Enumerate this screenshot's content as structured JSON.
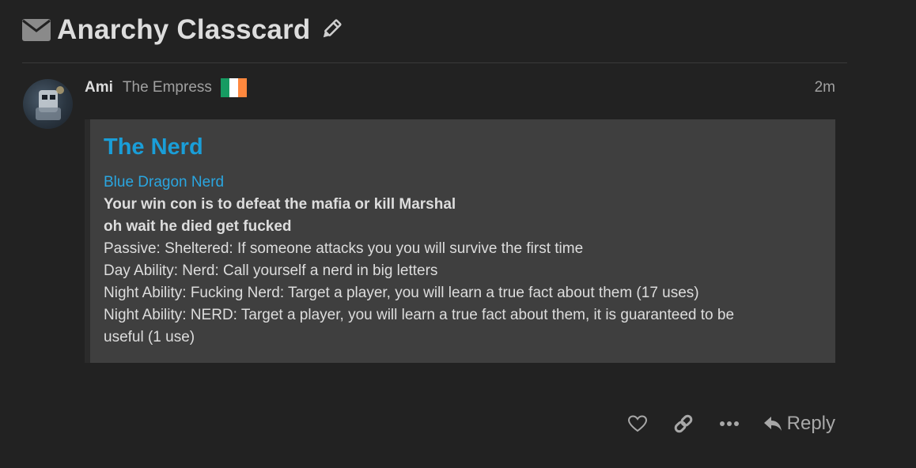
{
  "topic": {
    "title": "Anarchy Classcard",
    "icons": {
      "message_type": "envelope-icon",
      "edit": "pencil-icon"
    }
  },
  "post": {
    "username": "Ami",
    "user_title": "The Empress",
    "flag": {
      "name": "ireland-flag",
      "colors": [
        "#169b62",
        "#ffffff",
        "#ff883e"
      ]
    },
    "time": "2m",
    "content": {
      "heading": "The Nerd",
      "lines": [
        "Blue Dragon Nerd",
        "Your win con is to defeat the mafia or kill Marshal",
        "oh wait he died get fucked",
        "Passive: Sheltered: If someone attacks you you will survive the first time",
        "Day Ability: Nerd: Call yourself a nerd in big letters",
        "Night Ability: Fucking Nerd: Target a player, you will learn a true fact about them (17 uses)",
        "Night Ability: NERD: Target a player, you will learn a true fact about them, it is guaranteed to be",
        "useful (1 use)"
      ]
    },
    "actions": {
      "like_icon": "heart-icon",
      "link_icon": "link-icon",
      "more_icon": "ellipsis-icon",
      "reply_label": "Reply",
      "reply_icon": "reply-arrow-icon"
    }
  },
  "colors": {
    "background": "#222222",
    "quote_background": "#3f3f3f",
    "accent_blue": "#1a9ed8",
    "text": "#dddddd",
    "muted": "#a0a0a0"
  }
}
